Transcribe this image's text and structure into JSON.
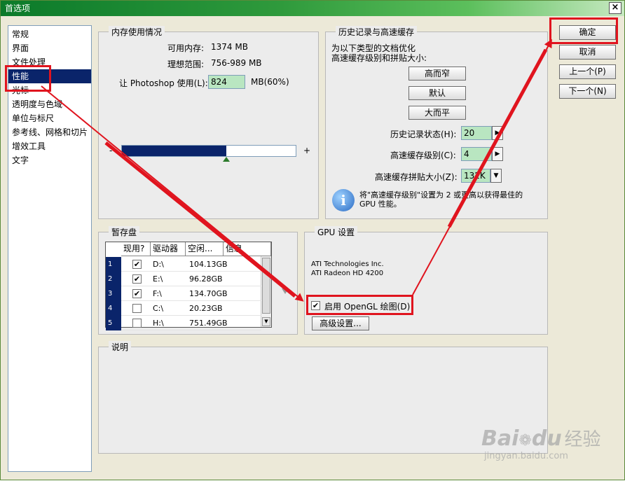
{
  "window": {
    "title": "首选项",
    "close_label": "×"
  },
  "nav": {
    "items": [
      {
        "label": "常规",
        "selected": false
      },
      {
        "label": "界面",
        "selected": false
      },
      {
        "label": "文件处理",
        "selected": false
      },
      {
        "label": "性能",
        "selected": true
      },
      {
        "label": "光标",
        "selected": false
      },
      {
        "label": "透明度与色域",
        "selected": false
      },
      {
        "label": "单位与标尺",
        "selected": false
      },
      {
        "label": "参考线、网格和切片",
        "selected": false
      },
      {
        "label": "增效工具",
        "selected": false
      },
      {
        "label": "文字",
        "selected": false
      }
    ]
  },
  "memory": {
    "title": "内存使用情况",
    "available_label": "可用内存:",
    "available_value": "1374 MB",
    "ideal_label": "理想范围:",
    "ideal_value": "756-989 MB",
    "use_label": "让 Photoshop 使用(L):",
    "use_value": "824",
    "use_unit": "MB(60%)",
    "slider_minus": "-",
    "slider_plus": "+",
    "slider_fraction": 0.6
  },
  "history": {
    "title": "历史记录与高速缓存",
    "desc_line1": "为以下类型的文档优化",
    "desc_line2": "高速缓存级别和拼贴大小:",
    "btn_tall": "高而窄",
    "btn_default": "默认",
    "btn_wide": "大而平",
    "states_label": "历史记录状态(H):",
    "states_value": "20",
    "cache_levels_label": "高速缓存级别(C):",
    "cache_levels_value": "4",
    "tile_size_label": "高速缓存拼贴大小(Z):",
    "tile_size_value": "132K",
    "info_line1": "将\"高速缓存级别\"设置为 2 或更高以获得最佳的",
    "info_line2": "GPU 性能。"
  },
  "scratch": {
    "title": "暂存盘",
    "headers": [
      "现用?",
      "驱动器",
      "空闲...",
      "信息"
    ],
    "rows": [
      {
        "num": "1",
        "checked": true,
        "drive": "D:\\",
        "free": "104.13GB"
      },
      {
        "num": "2",
        "checked": true,
        "drive": "E:\\",
        "free": "96.28GB"
      },
      {
        "num": "3",
        "checked": true,
        "drive": "F:\\",
        "free": "134.70GB"
      },
      {
        "num": "4",
        "checked": false,
        "drive": "C:\\",
        "free": "20.23GB"
      },
      {
        "num": "5",
        "checked": false,
        "drive": "H:\\",
        "free": "751.49GB"
      }
    ]
  },
  "gpu": {
    "title": "GPU 设置",
    "vendor": "ATI Technologies Inc.",
    "model": "ATI Radeon HD 4200",
    "opengl_label": "启用 OpenGL 绘图(D)",
    "opengl_checked": true,
    "advanced_label": "高级设置..."
  },
  "description": {
    "title": "说明"
  },
  "actions": {
    "ok_label": "确定",
    "cancel_label": "取消",
    "prev_label": "上一个(P)",
    "next_label": "下一个(N)"
  },
  "watermark": {
    "brand": "Bai",
    "brand2": "du",
    "brand_cn": "经验",
    "url": "jingyan.baidu.com"
  },
  "colors": {
    "annotation": "#e0141e",
    "selection": "#0a246a",
    "input_green": "#b9e6c1"
  }
}
